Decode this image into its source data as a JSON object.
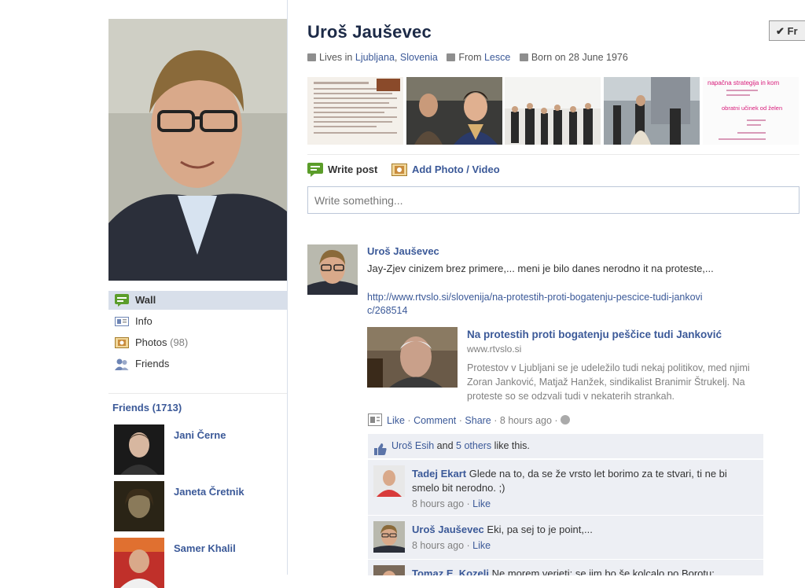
{
  "profile": {
    "name": "Uroš Jauševec",
    "info": {
      "lives_prefix": "Lives in",
      "city": "Ljubljana",
      "country": "Slovenia",
      "from_prefix": "From",
      "from_place": "Lesce",
      "born": "Born on 28 June 1976"
    },
    "friend_button_label": "Fr",
    "photo_strip_caption": "napačna strategija in kom obratni učinek od želen"
  },
  "sidebar": {
    "nav": [
      {
        "label": "Wall",
        "icon": "wall-icon"
      },
      {
        "label": "Info",
        "icon": "info-icon"
      },
      {
        "label": "Photos",
        "count": "(98)",
        "icon": "photos-icon"
      },
      {
        "label": "Friends",
        "icon": "friends-icon"
      }
    ],
    "friends_heading": "Friends (1713)",
    "friends": [
      {
        "name": "Jani Černe"
      },
      {
        "name": "Janeta Čretnik"
      },
      {
        "name": "Samer Khalil"
      }
    ]
  },
  "composer": {
    "tab_write": "Write post",
    "tab_photo": "Add Photo / Video",
    "placeholder": "Write something..."
  },
  "post": {
    "author": "Uroš Jauševec",
    "text": "Jay-Zjev cinizem brez primere,... meni je bilo danes nerodno it na proteste,...",
    "url": "http://www.rtvslo.si/slovenija/na-protestih-proti-bogatenju-pescice-tudi-jankovic/268514",
    "link_title": "Na protestih proti bogatenju peščice tudi Janković",
    "link_domain": "www.rtvslo.si",
    "link_desc": "Protestov v Ljubljani se je udeležilo tudi nekaj politikov, med njimi Zoran Janković, Matjaž Hanžek, sindikalist Branimir Štrukelj. Na proteste so se odzvali tudi v nekaterih strankah.",
    "actions": {
      "like": "Like",
      "comment": "Comment",
      "share": "Share",
      "time": "8 hours ago",
      "sep": "·"
    },
    "likes": {
      "name": "Uroš Esih",
      "and": "and",
      "others": "5 others",
      "suffix": "like this."
    },
    "comments": [
      {
        "author": "Tadej Ekart",
        "text": "Glede na to, da se že vrsto let borimo za te stvari, ti ne bi smelo bit nerodno. ;)",
        "time": "8 hours ago",
        "like": "Like"
      },
      {
        "author": "Uroš Jauševec",
        "text": "Eki, pa sej to je point,...",
        "time": "8 hours ago",
        "like": "Like"
      },
      {
        "author": "Tomaz E. Kozeli",
        "text": "Ne morem verjeti: se jim bo še kolcalo po Borotu:",
        "time": "",
        "like": ""
      }
    ]
  },
  "colors": {
    "link": "#3b5998",
    "nav_active": "#d8dfea",
    "comment_bg": "#edeff4"
  }
}
